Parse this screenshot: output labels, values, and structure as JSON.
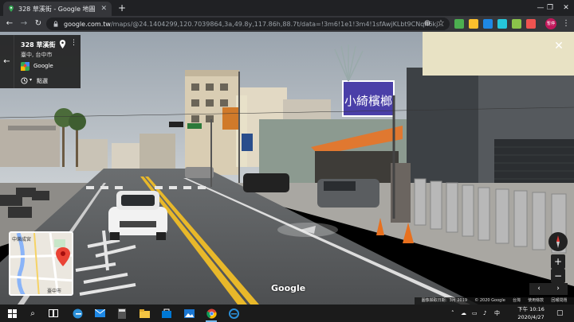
{
  "browser": {
    "tab_title": "328 草溪街 - Google 地圖",
    "new_tab": "+",
    "url_host": "google.com.tw",
    "url_path": "/maps/@24.1404299,120.7039864,3a,49.8y,117.86h,88.7t/data=!3m6!1e1!3m4!1sfAwjKLbt9CNqh6kj...",
    "avatar_text": "暫停"
  },
  "info_card": {
    "address": "328 草溪街",
    "city": "臺中, 台中市",
    "source": "Google",
    "history": "點選"
  },
  "scene": {
    "shop_sign": "小綺檳榔",
    "watermark": "Google"
  },
  "minimap": {
    "label_top": "中樂成宮",
    "label_bottom": "臺中市"
  },
  "footer": {
    "items": [
      "圖像擷取日期：3月 2019",
      "© 2020 Google",
      "台灣",
      "使用條款",
      "回報問題"
    ]
  },
  "taskbar": {
    "time": "下午 10:16",
    "date": "2020/4/27",
    "ime": "中"
  },
  "colors": {
    "accent": "#4285f4",
    "shop_sign_bg": "#4a3fa8",
    "awning": "#e07830"
  }
}
